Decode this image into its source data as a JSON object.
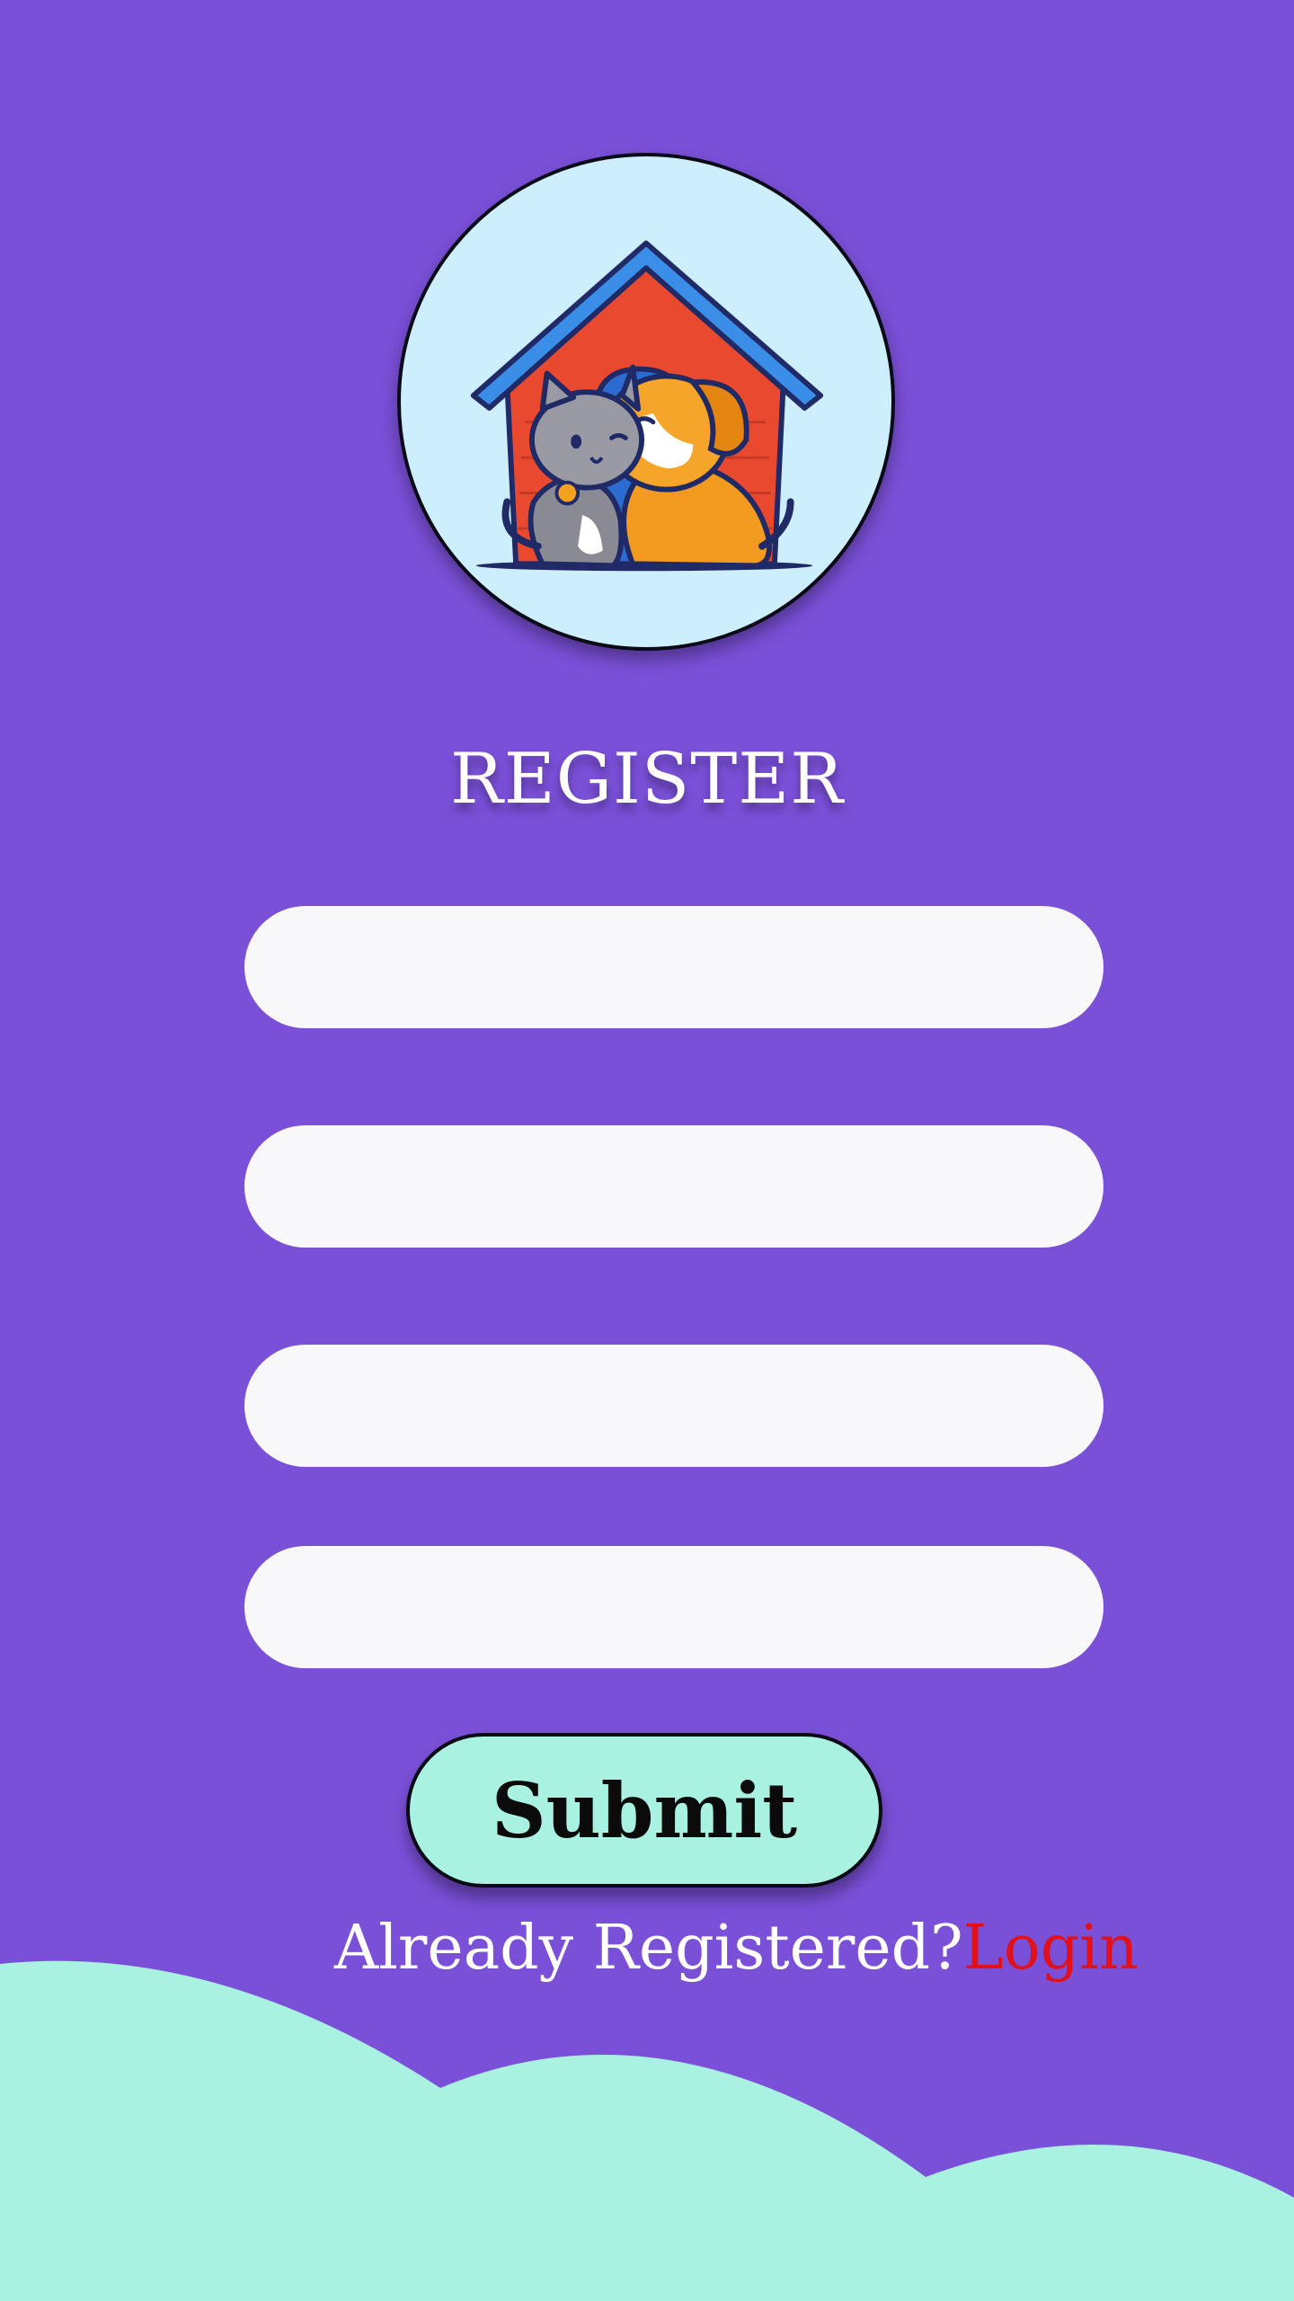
{
  "logo": {
    "icon": "cat-and-dog-pet-house-illustration",
    "circle_color": "#cdeffd"
  },
  "title": "REGISTER",
  "form": {
    "fields": [
      {
        "value": "",
        "placeholder": ""
      },
      {
        "value": "",
        "placeholder": ""
      },
      {
        "value": "",
        "placeholder": ""
      },
      {
        "value": "",
        "placeholder": ""
      }
    ],
    "submit_label": "Submit"
  },
  "footer": {
    "prompt": "Already Registered?",
    "link_label": "Login",
    "link_color": "#e0111a"
  },
  "colors": {
    "background": "#7a50d8",
    "accent": "#a9f2e2",
    "field": "#f8f8fa"
  }
}
